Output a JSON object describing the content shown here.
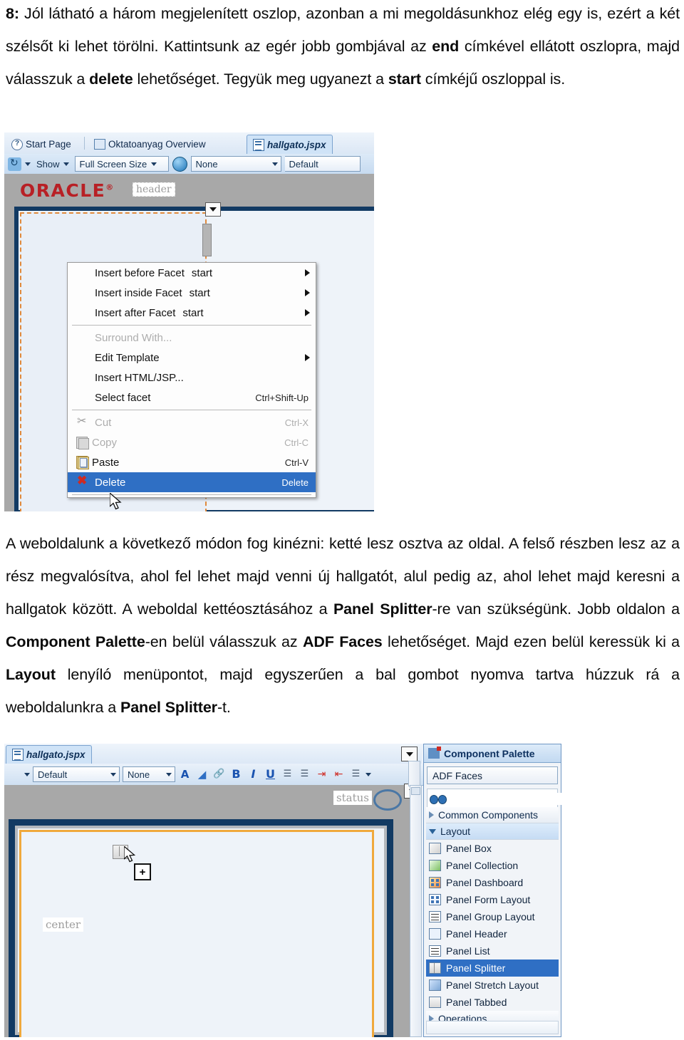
{
  "document": {
    "paragraph_top": {
      "number": "8:",
      "runs": [
        {
          "t": " Jól látható a három megjelenített oszlop, azonban a mi megoldásunkhoz elég egy is, ezért a két szélsőt ki lehet törölni. Kattintsunk az egér jobb gombjával az ",
          "b": false
        },
        {
          "t": "end",
          "b": true
        },
        {
          "t": " címkével ellátott oszlopra, majd válasszuk a ",
          "b": false
        },
        {
          "t": "delete",
          "b": true
        },
        {
          "t": " lehetőséget. Tegyük meg ugyanezt a ",
          "b": false
        },
        {
          "t": "start",
          "b": true
        },
        {
          "t": " címkéjű oszloppal is.",
          "b": false
        }
      ]
    },
    "paragraph_middle": {
      "runs": [
        {
          "t": "A weboldalunk a következő módon fog kinézni: ketté lesz osztva az oldal. A felső részben lesz az a rész megvalósítva, ahol fel lehet majd venni új hallgatót, alul pedig az, ahol lehet majd keresni a hallgatok között. A weboldal kettéosztásához a ",
          "b": false
        },
        {
          "t": "Panel Splitter",
          "b": true
        },
        {
          "t": "-re van szükségünk. Jobb oldalon a ",
          "b": false
        },
        {
          "t": "Component Palette",
          "b": true
        },
        {
          "t": "-en belül válasszuk az ",
          "b": false
        },
        {
          "t": "ADF Faces",
          "b": true
        },
        {
          "t": " lehetőséget. Majd ezen belül keressük ki a ",
          "b": false
        },
        {
          "t": "Layout",
          "b": true
        },
        {
          "t": " lenyíló menüpontot, majd egyszerűen a bal gombot nyomva tartva húzzuk rá a weboldalunkra a ",
          "b": false
        },
        {
          "t": "Panel Splitter",
          "b": true
        },
        {
          "t": "-t.",
          "b": false
        }
      ]
    }
  },
  "screenshot_top": {
    "tabs": [
      {
        "label": "Start Page",
        "icon": "help-icon",
        "active": false
      },
      {
        "label": "Oktatoanyag Overview",
        "icon": "overview-icon",
        "active": false
      },
      {
        "label": "hallgato.jspx",
        "icon": "jspx-file-icon",
        "active": true
      }
    ],
    "toolbar": {
      "refresh_icon": "refresh-page-icon",
      "show_label": "Show",
      "screen_size": "Full Screen Size",
      "globe_icon": "globe-icon",
      "skin": "None",
      "style": "Default"
    },
    "canvas": {
      "logo": "ORACLE",
      "logo_tm": "®",
      "header_facet": "header"
    },
    "context_menu": {
      "items": [
        {
          "label": "Insert before Facet",
          "extra": "start",
          "accel": "",
          "submenu": true,
          "disabled": false,
          "selected": false,
          "icon": ""
        },
        {
          "label": "Insert inside Facet",
          "extra": "start",
          "accel": "",
          "submenu": true,
          "disabled": false,
          "selected": false,
          "icon": ""
        },
        {
          "label": "Insert after Facet",
          "extra": "start",
          "accel": "",
          "submenu": true,
          "disabled": false,
          "selected": false,
          "icon": ""
        },
        {
          "separator": true
        },
        {
          "label": "Surround With...",
          "extra": "",
          "accel": "",
          "submenu": false,
          "disabled": true,
          "selected": false,
          "icon": ""
        },
        {
          "label": "Edit Template",
          "extra": "",
          "accel": "",
          "submenu": true,
          "disabled": false,
          "selected": false,
          "icon": ""
        },
        {
          "label": "Insert HTML/JSP...",
          "extra": "",
          "accel": "",
          "submenu": false,
          "disabled": false,
          "selected": false,
          "icon": ""
        },
        {
          "label": "Select facet",
          "extra": "",
          "accel": "Ctrl+Shift-Up",
          "submenu": false,
          "disabled": false,
          "selected": false,
          "icon": ""
        },
        {
          "separator": true
        },
        {
          "label": "Cut",
          "extra": "",
          "accel": "Ctrl-X",
          "submenu": false,
          "disabled": true,
          "selected": false,
          "icon": "cut-icon"
        },
        {
          "label": "Copy",
          "extra": "",
          "accel": "Ctrl-C",
          "submenu": false,
          "disabled": true,
          "selected": false,
          "icon": "copy-icon"
        },
        {
          "label": "Paste",
          "extra": "",
          "accel": "Ctrl-V",
          "submenu": false,
          "disabled": false,
          "selected": false,
          "icon": "paste-icon"
        },
        {
          "label": "Delete",
          "extra": "",
          "accel": "Delete",
          "submenu": false,
          "disabled": false,
          "selected": true,
          "icon": "delete-icon"
        },
        {
          "separator": true
        }
      ]
    }
  },
  "screenshot_bottom": {
    "tabs": [
      {
        "label": "hallgato.jspx",
        "icon": "jspx-file-icon",
        "active": true
      }
    ],
    "toolbar": {
      "style": "Default",
      "skin": "None",
      "buttons": [
        {
          "name": "font-color-icon",
          "glyph": "A"
        },
        {
          "name": "fill-color-icon",
          "glyph": "◢"
        },
        {
          "name": "link-icon",
          "glyph": "🔗"
        },
        {
          "name": "bold-icon",
          "glyph": "B"
        },
        {
          "name": "italic-icon",
          "glyph": "I"
        },
        {
          "name": "underline-icon",
          "glyph": "U"
        },
        {
          "name": "bulleted-list-icon",
          "glyph": "☰"
        },
        {
          "name": "numbered-list-icon",
          "glyph": "☰"
        },
        {
          "name": "increase-indent-icon",
          "glyph": "⇥"
        },
        {
          "name": "decrease-indent-icon",
          "glyph": "⇤"
        },
        {
          "name": "align-icon",
          "glyph": "☰"
        }
      ]
    },
    "canvas": {
      "status_facet": "status",
      "center_facet": "center"
    },
    "palette": {
      "title": "Component Palette",
      "library": "ADF Faces",
      "search_placeholder": "",
      "search_value": "",
      "groups": [
        {
          "label": "Common Components",
          "expanded": false,
          "items": []
        },
        {
          "label": "Layout",
          "expanded": true,
          "items": [
            {
              "label": "Panel Box",
              "icon": "panel-box-icon",
              "selected": false
            },
            {
              "label": "Panel Collection",
              "icon": "panel-collection-icon",
              "selected": false
            },
            {
              "label": "Panel Dashboard",
              "icon": "panel-dashboard-icon",
              "selected": false
            },
            {
              "label": "Panel Form Layout",
              "icon": "panel-form-layout-icon",
              "selected": false
            },
            {
              "label": "Panel Group Layout",
              "icon": "panel-group-layout-icon",
              "selected": false
            },
            {
              "label": "Panel Header",
              "icon": "panel-header-icon",
              "selected": false
            },
            {
              "label": "Panel List",
              "icon": "panel-list-icon",
              "selected": false
            },
            {
              "label": "Panel Splitter",
              "icon": "panel-splitter-icon",
              "selected": true
            },
            {
              "label": "Panel Stretch Layout",
              "icon": "panel-stretch-layout-icon",
              "selected": false
            },
            {
              "label": "Panel Tabbed",
              "icon": "panel-tabbed-icon",
              "selected": false
            }
          ]
        },
        {
          "label": "Operations",
          "expanded": false,
          "items": []
        }
      ]
    }
  },
  "colors": {
    "selection_blue": "#2f6fc4",
    "oracle_red": "#b82025",
    "frame_navy": "#123a63",
    "orange_dashed": "#e08a3c",
    "canvas_gray": "#a8a8a8"
  }
}
